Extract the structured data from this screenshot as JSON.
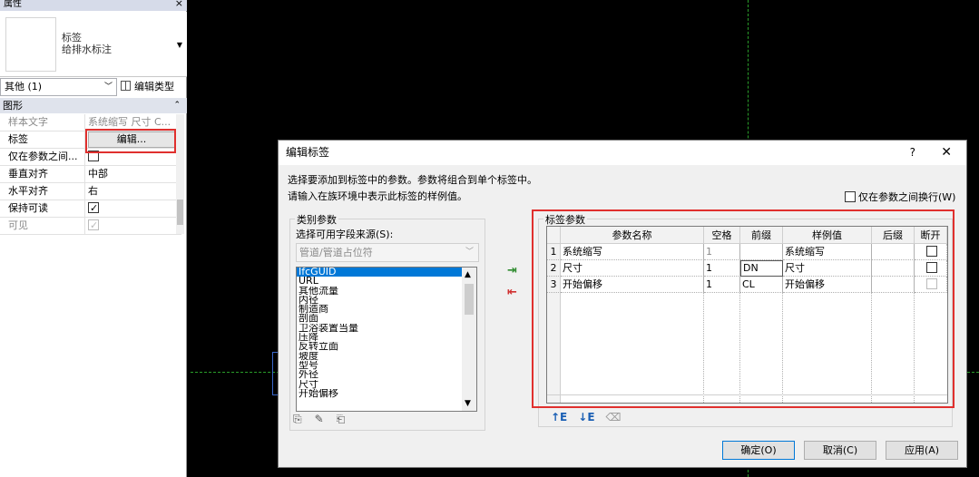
{
  "properties": {
    "title": "属性",
    "close": "×",
    "type_name_line1": "标签",
    "type_name_line2": "给排水标注",
    "filter": "其他 (1)",
    "edit_type": "编辑类型",
    "group": "图形",
    "rows": [
      {
        "label": "样本文字",
        "value": "系统缩写 尺寸 C..."
      },
      {
        "label": "标签",
        "value": "编辑..."
      },
      {
        "label": "仅在参数之间...",
        "value": ""
      },
      {
        "label": "垂直对齐",
        "value": "中部"
      },
      {
        "label": "水平对齐",
        "value": "右"
      },
      {
        "label": "保持可读",
        "value": ""
      },
      {
        "label": "可见",
        "value": ""
      }
    ],
    "checks": {
      "wrap_between_params": false,
      "keep_readable": true,
      "visible": true
    }
  },
  "dialog": {
    "title": "编辑标签",
    "help": "?",
    "close": "✕",
    "desc1": "选择要添加到标签中的参数。参数将组合到单个标签中。",
    "desc2": "请输入在族环境中表示此标签的样例值。",
    "wrap_option": "仅在参数之间换行(W)",
    "wrap_checked": false,
    "category": {
      "legend": "类别参数",
      "source_label": "选择可用字段来源(S):",
      "source_value": "管道/管道占位符",
      "fields": [
        "IfcGUID",
        "URL",
        "其他流量",
        "内径",
        "制造商",
        "剖面",
        "卫浴装置当量",
        "压降",
        "反转立面",
        "坡度",
        "型号",
        "外径",
        "尺寸",
        "开始偏移"
      ],
      "selected": "IfcGUID"
    },
    "label_params": {
      "legend": "标签参数",
      "headers": [
        "参数名称",
        "空格",
        "前缀",
        "样例值",
        "后缀",
        "断开"
      ],
      "rows": [
        {
          "num": "1",
          "name": "系统缩写",
          "space": "1",
          "prefix": "",
          "sample": "系统缩写",
          "suffix": "",
          "break": false
        },
        {
          "num": "2",
          "name": "尺寸",
          "space": "1",
          "prefix": "DN",
          "sample": "尺寸",
          "suffix": "",
          "break": false
        },
        {
          "num": "3",
          "name": "开始偏移",
          "space": "1",
          "prefix": "CL",
          "sample": "开始偏移",
          "suffix": "",
          "break": false
        }
      ]
    },
    "buttons": {
      "ok": "确定(O)",
      "cancel": "取消(C)",
      "apply": "应用(A)"
    }
  }
}
